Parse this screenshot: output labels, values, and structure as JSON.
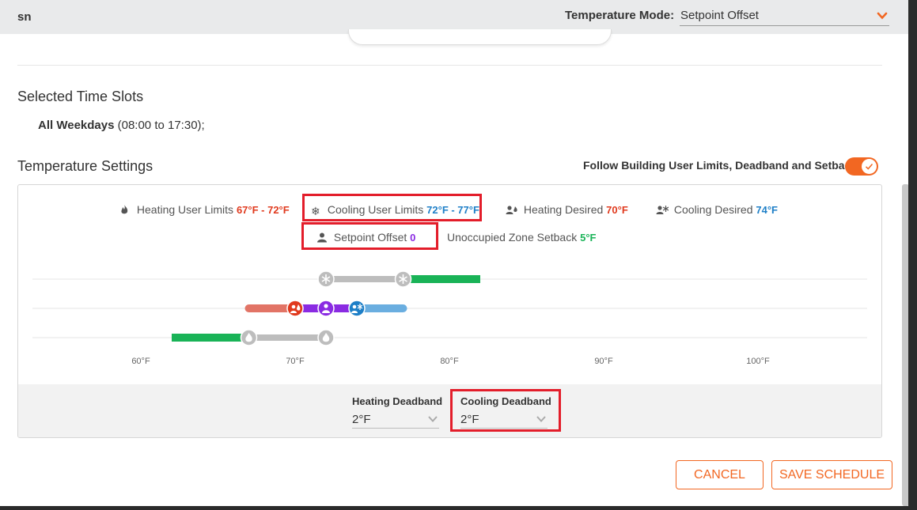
{
  "header": {
    "name": "sn",
    "mode_label": "Temperature Mode:",
    "mode_value": "Setpoint Offset"
  },
  "time_slots": {
    "title": "Selected Time Slots",
    "day": "All Weekdays",
    "range": " (08:00 to 17:30);"
  },
  "temperature_settings": {
    "title": "Temperature Settings",
    "follow_label": "Follow Building User Limits, Deadband and Setback",
    "follow_enabled": true
  },
  "legend": {
    "heating_limits_label": "Heating User Limits",
    "heating_limits_value": "67°F - 72°F",
    "cooling_limits_label": "Cooling User Limits",
    "cooling_limits_value": "72°F - 77°F",
    "heating_desired_label": "Heating Desired",
    "heating_desired_value": "70°F",
    "cooling_desired_label": "Cooling Desired",
    "cooling_desired_value": "74°F",
    "setpoint_offset_label": "Setpoint Offset",
    "setpoint_offset_value": "0",
    "setback_label": "Unoccupied Zone Setback",
    "setback_value": "5°F"
  },
  "slider": {
    "ticks": [
      "60°F",
      "70°F",
      "80°F",
      "90°F",
      "100°F"
    ],
    "tick_values": [
      60,
      70,
      80,
      90,
      100
    ],
    "cooling_limit_low": 72,
    "cooling_limit_high": 77,
    "cooling_setback_high": 82,
    "heating_limit_low": 67,
    "heating_limit_high": 72,
    "heating_setback_low": 62,
    "heating_desired": 70,
    "cooling_desired": 74,
    "setpoint": 72,
    "desired_range_low": 67,
    "desired_range_high": 77,
    "colors": {
      "setback": "#19b357",
      "limit": "#bdbdbd",
      "heating": "#e03a1e",
      "heating_light": "#e27466",
      "cooling": "#1e7fc7",
      "cooling_light": "#6aaee0",
      "setpoint": "#8a2be2"
    }
  },
  "deadband": {
    "heating_label": "Heating Deadband",
    "heating_value": "2°F",
    "cooling_label": "Cooling Deadband",
    "cooling_value": "2°F"
  },
  "buttons": {
    "cancel": "CANCEL",
    "save": "SAVE SCHEDULE"
  }
}
